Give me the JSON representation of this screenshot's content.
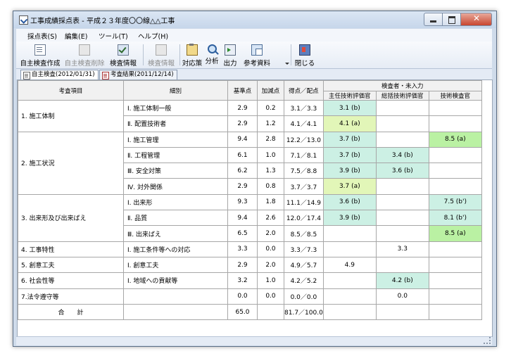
{
  "window": {
    "title": "工事成績採点表 - 平成２３年度〇〇線△△工事"
  },
  "menu": [
    "採点表(S)",
    "編集(E)",
    "ツール(T)",
    "ヘルプ(H)"
  ],
  "toolbar": [
    {
      "label": "自主検査作成",
      "icon": "document-icon",
      "enabled": true
    },
    {
      "label": "自主検査削除",
      "icon": "document-delete-icon",
      "enabled": false
    },
    {
      "label": "検査情報",
      "icon": "inspection-info-icon",
      "enabled": true
    },
    {
      "label": "検査情報",
      "icon": "inspection-info-icon",
      "enabled": false
    },
    {
      "label": "対応策",
      "icon": "clipboard-icon",
      "enabled": true
    },
    {
      "label": "分析",
      "icon": "magnifier-icon",
      "enabled": true
    },
    {
      "label": "出力",
      "icon": "output-icon",
      "enabled": true
    },
    {
      "label": "参考資料",
      "icon": "reference-icon",
      "enabled": true
    },
    {
      "label": "閉じる",
      "icon": "exit-icon",
      "enabled": true
    }
  ],
  "tabs": [
    {
      "label": "自主検査(2012/01/31)",
      "active": true
    },
    {
      "label": "考査結果(2011/12/14)",
      "active": false
    }
  ],
  "table": {
    "headers": {
      "category": "考査項目",
      "detail": "細別",
      "base": "基準点",
      "bonus": "加減点",
      "ratio": "得点／配点",
      "inspectors_group": "検査者・未入力",
      "inspectors": [
        "主任技術評価官",
        "総括技術評価官",
        "技術検査官"
      ]
    },
    "categories": [
      {
        "name": "1. 施工体制",
        "rows": [
          {
            "detail": "Ⅰ. 施工体制一般",
            "base": "2.9",
            "bonus": "0.2",
            "ratio": "3.1／3.3",
            "scores": [
              {
                "v": "3.1 (b)",
                "c": "g1"
              },
              {
                "v": "",
                "c": ""
              },
              {
                "v": "",
                "c": ""
              }
            ]
          },
          {
            "detail": "Ⅱ. 配置技術者",
            "base": "2.9",
            "bonus": "1.2",
            "ratio": "4.1／4.1",
            "scores": [
              {
                "v": "4.1 (a)",
                "c": "g2"
              },
              {
                "v": "",
                "c": ""
              },
              {
                "v": "",
                "c": ""
              }
            ]
          }
        ]
      },
      {
        "name": "2. 施工状況",
        "rows": [
          {
            "detail": "Ⅰ. 施工管理",
            "base": "9.4",
            "bonus": "2.8",
            "ratio": "12.2／13.0",
            "scores": [
              {
                "v": "3.7 (b)",
                "c": "g1"
              },
              {
                "v": "",
                "c": ""
              },
              {
                "v": "8.5 (a)",
                "c": "g3"
              }
            ]
          },
          {
            "detail": "Ⅱ. 工程管理",
            "base": "6.1",
            "bonus": "1.0",
            "ratio": "7.1／8.1",
            "scores": [
              {
                "v": "3.7 (b)",
                "c": "g1"
              },
              {
                "v": "3.4 (b)",
                "c": "g1"
              },
              {
                "v": "",
                "c": ""
              }
            ]
          },
          {
            "detail": "Ⅲ. 安全対策",
            "base": "6.2",
            "bonus": "1.3",
            "ratio": "7.5／8.8",
            "scores": [
              {
                "v": "3.9 (b)",
                "c": "g1"
              },
              {
                "v": "3.6 (b)",
                "c": "g1"
              },
              {
                "v": "",
                "c": ""
              }
            ]
          },
          {
            "detail": "Ⅳ. 対外関係",
            "base": "2.9",
            "bonus": "0.8",
            "ratio": "3.7／3.7",
            "scores": [
              {
                "v": "3.7 (a)",
                "c": "g2"
              },
              {
                "v": "",
                "c": ""
              },
              {
                "v": "",
                "c": ""
              }
            ]
          }
        ]
      },
      {
        "name": "3. 出来形及び出来ばえ",
        "rows": [
          {
            "detail": "Ⅰ. 出来形",
            "base": "9.3",
            "bonus": "1.8",
            "ratio": "11.1／14.9",
            "scores": [
              {
                "v": "3.6 (b)",
                "c": "g1"
              },
              {
                "v": "",
                "c": ""
              },
              {
                "v": "7.5 (b')",
                "c": "g1"
              }
            ]
          },
          {
            "detail": "Ⅱ. 品質",
            "base": "9.4",
            "bonus": "2.6",
            "ratio": "12.0／17.4",
            "scores": [
              {
                "v": "3.9 (b)",
                "c": "g1"
              },
              {
                "v": "",
                "c": ""
              },
              {
                "v": "8.1 (b')",
                "c": "g1"
              }
            ]
          },
          {
            "detail": "Ⅲ. 出来ばえ",
            "base": "6.5",
            "bonus": "2.0",
            "ratio": "8.5／8.5",
            "scores": [
              {
                "v": "",
                "c": ""
              },
              {
                "v": "",
                "c": ""
              },
              {
                "v": "8.5 (a)",
                "c": "g3"
              }
            ]
          }
        ]
      },
      {
        "name": "4. 工事特性",
        "rows": [
          {
            "detail": "Ⅰ. 施工条件等への対応",
            "base": "3.3",
            "bonus": "0.0",
            "ratio": "3.3／7.3",
            "scores": [
              {
                "v": "",
                "c": ""
              },
              {
                "v": "3.3",
                "c": ""
              },
              {
                "v": "",
                "c": ""
              }
            ]
          }
        ]
      },
      {
        "name": "5. 創意工夫",
        "rows": [
          {
            "detail": "Ⅰ. 創意工夫",
            "base": "2.9",
            "bonus": "2.0",
            "ratio": "4.9／5.7",
            "scores": [
              {
                "v": "4.9",
                "c": ""
              },
              {
                "v": "",
                "c": ""
              },
              {
                "v": "",
                "c": ""
              }
            ]
          }
        ]
      },
      {
        "name": "6. 社会性等",
        "rows": [
          {
            "detail": "Ⅰ. 地域への貢献等",
            "base": "3.2",
            "bonus": "1.0",
            "ratio": "4.2／5.2",
            "scores": [
              {
                "v": "",
                "c": ""
              },
              {
                "v": "4.2 (b)",
                "c": "g1"
              },
              {
                "v": "",
                "c": ""
              }
            ]
          }
        ]
      },
      {
        "name": "7.法令遵守等",
        "rows": [
          {
            "detail": "",
            "base": "0.0",
            "bonus": "0.0",
            "ratio": "0.0／0.0",
            "scores": [
              {
                "v": "",
                "c": ""
              },
              {
                "v": "0.0",
                "c": ""
              },
              {
                "v": "",
                "c": ""
              }
            ]
          }
        ]
      }
    ],
    "total": {
      "label": "合　　計",
      "base": "65.0",
      "bonus": "",
      "ratio": "81.7／100.0"
    }
  }
}
